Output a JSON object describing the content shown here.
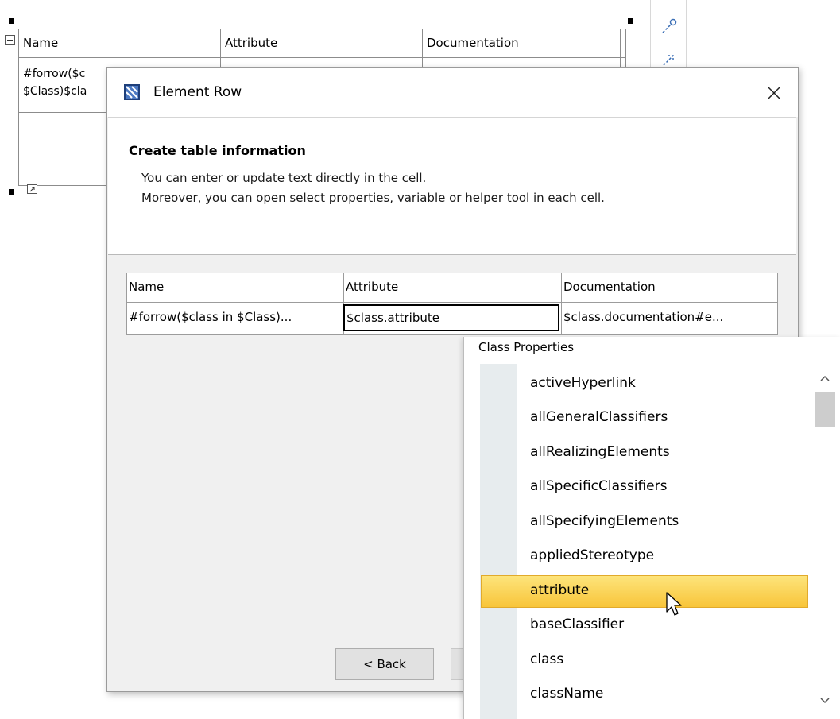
{
  "background_table": {
    "headers": [
      "Name",
      "Attribute",
      "Documentation"
    ],
    "row_partial": [
      "#forrow($c",
      "$Class)$cla"
    ]
  },
  "dialog": {
    "title": "Element Row",
    "close_glyph": "✕",
    "header": {
      "title": "Create table information",
      "line1": "You can enter or update text directly in the cell.",
      "line2": "Moreover, you can open select properties, variable or helper tool in each cell."
    },
    "table": {
      "headers": [
        "Name",
        "Attribute",
        "Documentation"
      ],
      "row": [
        "#forrow($class in $Class)...",
        "$class.attribute",
        "$class.documentation#e..."
      ]
    },
    "buttons": {
      "back": "< Back"
    }
  },
  "popup": {
    "legend": "Class Properties",
    "items": [
      "activeHyperlink",
      "allGeneralClassifiers",
      "allRealizingElements",
      "allSpecificClassifiers",
      "allSpecifyingElements",
      "appliedStereotype",
      "attribute",
      "baseClassifier",
      "class",
      "className"
    ],
    "selected": "attribute"
  },
  "icons": {
    "dialog_icon": "element-row-dialog-icon",
    "side_tool_1": "link-pin-icon",
    "side_tool_2": "resize-arrow-icon",
    "cursor": "mouse-pointer-icon"
  },
  "colors": {
    "selection_fill": "#f8c53a",
    "selection_border": "#e1aa2b",
    "gutter": "#e7ecee"
  }
}
